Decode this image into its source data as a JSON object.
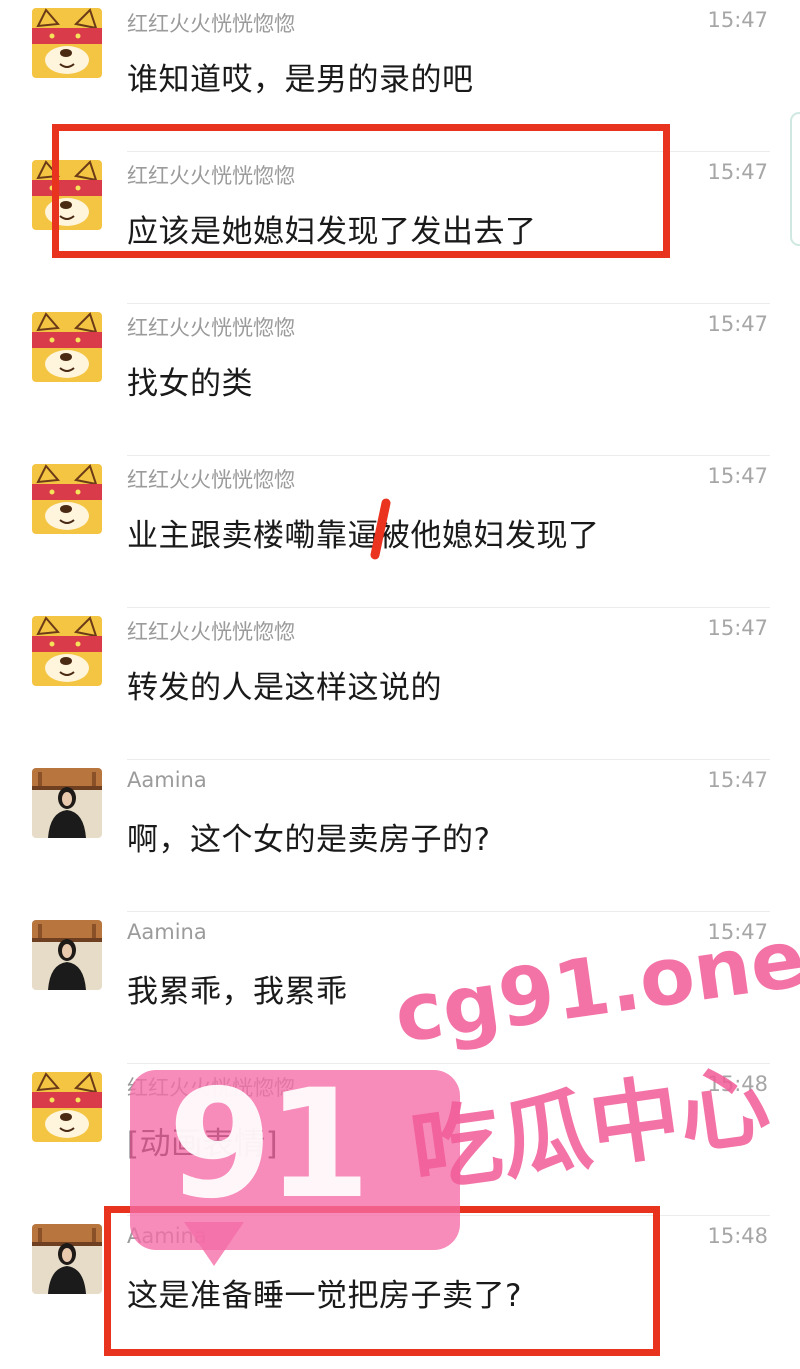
{
  "messages": [
    {
      "sender": "红红火火恍恍惚惚",
      "time": "15:47",
      "text": "谁知道哎，是男的录的吧",
      "avatar": "dog-avatar"
    },
    {
      "sender": "红红火火恍恍惚惚",
      "time": "15:47",
      "text": "应该是她媳妇发现了发出去了",
      "avatar": "dog-avatar"
    },
    {
      "sender": "红红火火恍恍惚惚",
      "time": "15:47",
      "text": "找女的类",
      "avatar": "dog-avatar"
    },
    {
      "sender": "红红火火恍恍惚惚",
      "time": "15:47",
      "text": "业主跟卖楼嘞靠逼被他媳妇发现了",
      "avatar": "dog-avatar"
    },
    {
      "sender": "红红火火恍恍惚惚",
      "time": "15:47",
      "text": "转发的人是这样这说的",
      "avatar": "dog-avatar"
    },
    {
      "sender": "Aamina",
      "time": "15:47",
      "text": "啊，这个女的是卖房子的?",
      "avatar": "woman-avatar"
    },
    {
      "sender": "Aamina",
      "time": "15:47",
      "text": "我累乖，我累乖",
      "avatar": "woman-avatar"
    },
    {
      "sender": "红红火火恍恍惚惚",
      "time": "15:48",
      "text": "[动画表情]",
      "avatar": "dog-avatar"
    },
    {
      "sender": "Aamina",
      "time": "15:48",
      "text": "这是准备睡一觉把房子卖了?",
      "avatar": "woman-avatar"
    }
  ],
  "watermark": {
    "badge_number": "91",
    "site": "cg91.one",
    "chinese": "吃瓜中心"
  },
  "colors": {
    "highlight_box": "#e8331f",
    "watermark_pink": "#f15b97"
  }
}
